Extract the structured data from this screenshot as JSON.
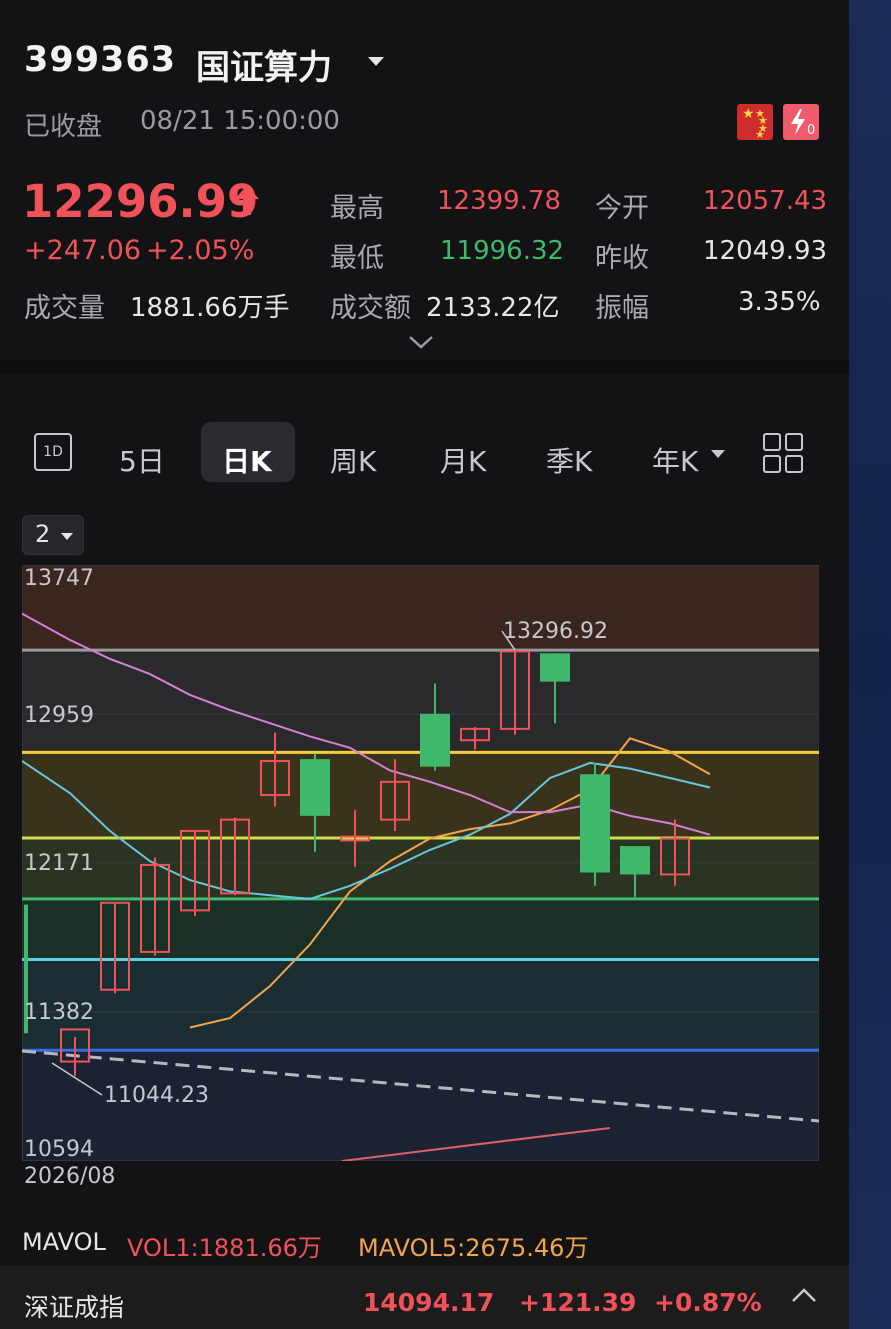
{
  "header": {
    "code": "399363",
    "name": "国证算力",
    "status": "已收盘",
    "datetime": "08/21 15:00:00",
    "price": "12296.99",
    "change": "+247.06",
    "change_pct": "+2.05%",
    "volume_label": "成交量",
    "volume_value": "1881.66万手",
    "stats": {
      "high_label": "最高",
      "high_value": "12399.78",
      "open_label": "今开",
      "open_value": "12057.43",
      "low_label": "最低",
      "low_value": "11996.32",
      "prev_close_label": "昨收",
      "prev_close_value": "12049.93",
      "amount_label": "成交额",
      "amount_value": "2133.22亿",
      "amplitude_label": "振幅",
      "amplitude_value": "3.35%"
    },
    "colors": {
      "up": "#f0525a",
      "down": "#3fb86b"
    }
  },
  "tabs": {
    "icon_label": "1D",
    "items": [
      "5日",
      "日K",
      "周K",
      "月K",
      "季K",
      "年K"
    ],
    "active": "日K"
  },
  "chart_selector": "2",
  "chart_data": {
    "type": "candlestick",
    "y_tick_labels": [
      "13747",
      "12959",
      "12171",
      "11382",
      "10594"
    ],
    "ylim": [
      10594,
      13747
    ],
    "x_label": "2026/08",
    "annotations": [
      {
        "text": "13296.92",
        "type": "high"
      },
      {
        "text": "11044.23",
        "type": "low"
      }
    ],
    "candles": [
      {
        "o": 11950,
        "c": 11270,
        "h": 11950,
        "l": 11270
      },
      {
        "o": 11120,
        "c": 11290,
        "h": 11250,
        "l": 11044.23
      },
      {
        "o": 11500,
        "c": 11960,
        "h": 11960,
        "l": 11480
      },
      {
        "o": 11700,
        "c": 12160,
        "h": 12200,
        "l": 11680
      },
      {
        "o": 11920,
        "c": 12340,
        "h": 12340,
        "l": 11890
      },
      {
        "o": 12010,
        "c": 12400,
        "h": 12410,
        "l": 12000
      },
      {
        "o": 12530,
        "c": 12710,
        "h": 12860,
        "l": 12470
      },
      {
        "o": 12720,
        "c": 12420,
        "h": 12750,
        "l": 12230
      },
      {
        "o": 12290,
        "c": 12310,
        "h": 12450,
        "l": 12150
      },
      {
        "o": 12400,
        "c": 12600,
        "h": 12720,
        "l": 12340
      },
      {
        "o": 12960,
        "c": 12680,
        "h": 13120,
        "l": 12660
      },
      {
        "o": 12820,
        "c": 12880,
        "h": 12890,
        "l": 12770
      },
      {
        "o": 12880,
        "c": 13290,
        "h": 13296.92,
        "l": 12850
      },
      {
        "o": 13280,
        "c": 13130,
        "h": 13280,
        "l": 12910
      },
      {
        "o": 12640,
        "c": 12120,
        "h": 12700,
        "l": 12050
      },
      {
        "o": 12260,
        "c": 12110,
        "h": 12260,
        "l": 11990
      },
      {
        "o": 12110,
        "c": 12300,
        "h": 12400,
        "l": 12050
      }
    ],
    "ma_lines": [
      {
        "color": "#f2a44c",
        "values": [
          null,
          null,
          null,
          null,
          11300,
          11350,
          11520,
          11740,
          12020,
          12180,
          12300,
          12350,
          12380,
          12450,
          12560,
          12830,
          12760,
          12640
        ]
      },
      {
        "color": "#68c6dd",
        "values": [
          12710,
          12540,
          12340,
          12180,
          12080,
          12020,
          12000,
          11980,
          12050,
          12140,
          12240,
          12320,
          12430,
          12620,
          12700,
          12670,
          12620,
          12570
        ]
      },
      {
        "color": "#d67fd6",
        "values": [
          13490,
          13350,
          13250,
          13170,
          13060,
          12980,
          12910,
          12840,
          12780,
          12660,
          12600,
          12530,
          12440,
          12440,
          12480,
          12420,
          12380,
          12320
        ]
      }
    ],
    "horizontal_lines": [
      {
        "value": 13296.92,
        "color": "#9a9a9e"
      },
      {
        "value": 12756,
        "color": "#f4cf3c"
      },
      {
        "value": 12303,
        "color": "#cde04c"
      },
      {
        "value": 11981,
        "color": "#3dbb6e"
      },
      {
        "value": 11660,
        "color": "#5ad0e0"
      },
      {
        "value": 11180,
        "color": "#3e6ce0"
      }
    ],
    "bands": [
      {
        "from": 13296.92,
        "to": 13747,
        "color": "#3a261e"
      },
      {
        "from": 12756,
        "to": 13296.92,
        "color": "#2a2a2c"
      },
      {
        "from": 12303,
        "to": 12756,
        "color": "#3a331c"
      },
      {
        "from": 11981,
        "to": 12303,
        "color": "#2b3322"
      },
      {
        "from": 11660,
        "to": 11981,
        "color": "#1a3026"
      },
      {
        "from": 11180,
        "to": 11660,
        "color": "#1a2d33"
      },
      {
        "from": 10594,
        "to": 11180,
        "color": "#1a2233"
      }
    ]
  },
  "mavol": {
    "label": "MAVOL",
    "vol1": "VOL1:1881.66万",
    "mavol5": "MAVOL5:2675.46万",
    "vol1_color": "#f0525a",
    "mavol5_color": "#f2a44c"
  },
  "bottom_bar": {
    "name": "深证成指",
    "value": "14094.17",
    "change": "+121.39",
    "change_pct": "+0.87%"
  }
}
